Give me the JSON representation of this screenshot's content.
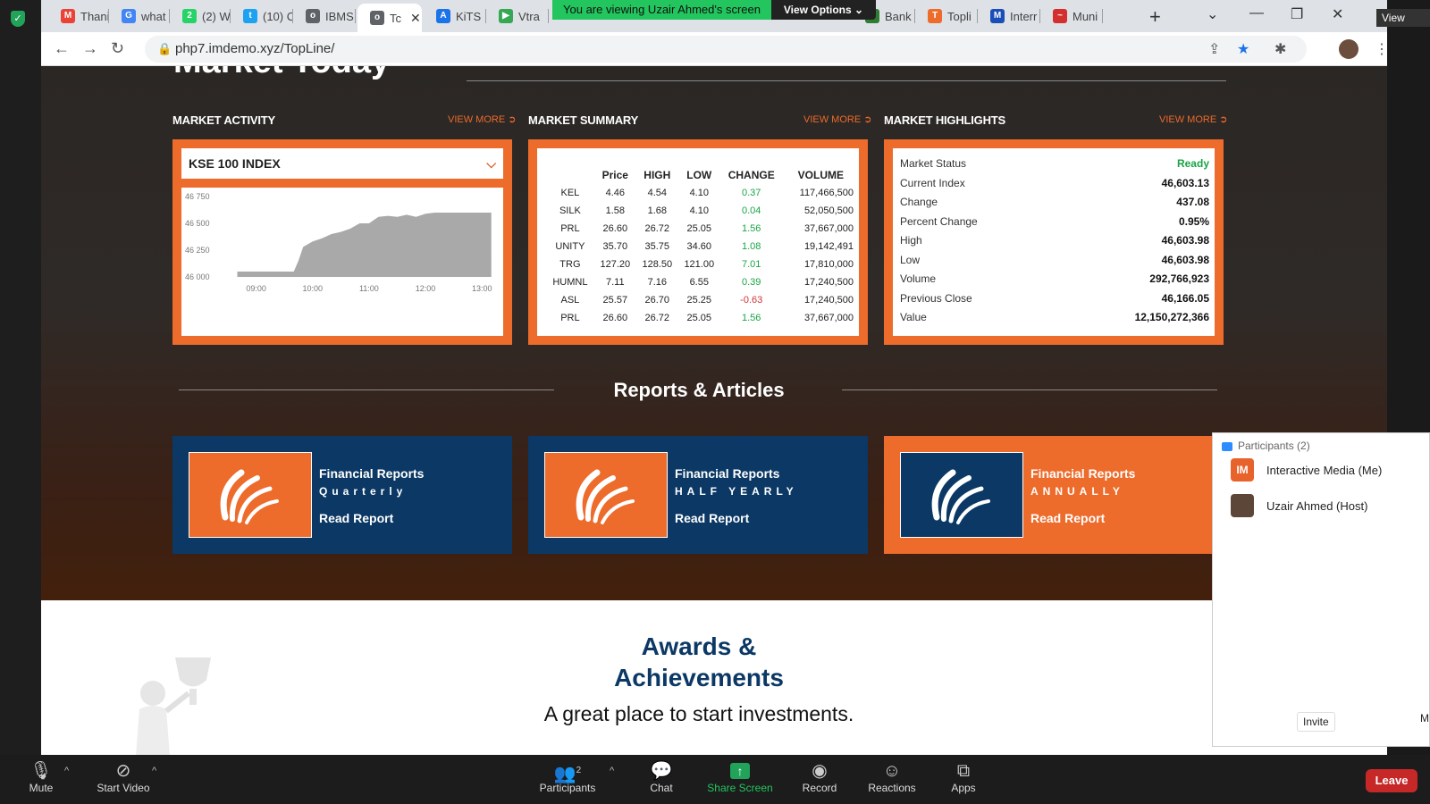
{
  "zoom": {
    "viewing_banner": "You are viewing Uzair Ahmed's screen",
    "view_options": "View Options",
    "view_corner": "View",
    "participants_count": "2",
    "bottom": {
      "mute": "Mute",
      "start_video": "Start Video",
      "participants": "Participants",
      "chat": "Chat",
      "share_screen": "Share Screen",
      "record": "Record",
      "reactions": "Reactions",
      "apps": "Apps",
      "leave": "Leave"
    },
    "participants_panel": {
      "title": "Participants (2)",
      "people": [
        {
          "initials": "IM",
          "name": "Interactive Media (Me)",
          "color": "#e8632b"
        },
        {
          "initials": "",
          "name": "Uzair Ahmed (Host)",
          "color": "#5b4638"
        }
      ],
      "invite": "Invite",
      "more": "M"
    }
  },
  "browser": {
    "tabs": [
      {
        "label": "Thani",
        "icon": "gmail-icon",
        "color": "#ea4335",
        "glyph": "M"
      },
      {
        "label": "what",
        "icon": "google-icon",
        "color": "#4285f4",
        "glyph": "G"
      },
      {
        "label": "(2) W",
        "icon": "whatsapp-icon",
        "color": "#25d366",
        "glyph": "2"
      },
      {
        "label": "(10) C",
        "icon": "twitter-icon",
        "color": "#1da1f2",
        "glyph": "t"
      },
      {
        "label": "IBMS",
        "icon": "globe-icon",
        "color": "#5f6368",
        "glyph": "o"
      },
      {
        "label": "Tc",
        "icon": "globe-icon",
        "color": "#5f6368",
        "glyph": "o",
        "active": true
      },
      {
        "label": "KiTS",
        "icon": "appstore-icon",
        "color": "#1a73e8",
        "glyph": "A"
      },
      {
        "label": "Vtra",
        "icon": "play-icon",
        "color": "#34a853",
        "glyph": "▶"
      },
      {
        "label": "Bank",
        "icon": "bank-icon",
        "color": "#2e7d32",
        "glyph": "B"
      },
      {
        "label": "Topli",
        "icon": "topline-icon",
        "color": "#ed6b2b",
        "glyph": "T"
      },
      {
        "label": "Interr",
        "icon": "meta-icon",
        "color": "#1a4fb8",
        "glyph": "M"
      },
      {
        "label": "Muni",
        "icon": "muni-icon",
        "color": "#d32f2f",
        "glyph": "~"
      }
    ],
    "url": "php7.imdemo.xyz/TopLine/"
  },
  "page": {
    "headline": "Market Today",
    "sections": {
      "activity": "MARKET ACTIVITY",
      "summary": "MARKET SUMMARY",
      "highlights": "MARKET HIGHLIGHTS",
      "view_more": "VIEW MORE"
    },
    "index_select": "KSE 100 INDEX",
    "summary_headers": [
      "",
      "Price",
      "HIGH",
      "LOW",
      "CHANGE",
      "VOLUME"
    ],
    "summary_rows": [
      [
        "KEL",
        "4.46",
        "4.54",
        "4.10",
        "0.37",
        "117,466,500"
      ],
      [
        "SILK",
        "1.58",
        "1.68",
        "4.10",
        "0.04",
        "52,050,500"
      ],
      [
        "PRL",
        "26.60",
        "26.72",
        "25.05",
        "1.56",
        "37,667,000"
      ],
      [
        "UNITY",
        "35.70",
        "35.75",
        "34.60",
        "1.08",
        "19,142,491"
      ],
      [
        "TRG",
        "127.20",
        "128.50",
        "121.00",
        "7.01",
        "17,810,000"
      ],
      [
        "HUMNL",
        "7.11",
        "7.16",
        "6.55",
        "0.39",
        "17,240,500"
      ],
      [
        "ASL",
        "25.57",
        "26.70",
        "25.25",
        "-0.63",
        "17,240,500"
      ],
      [
        "PRL",
        "26.60",
        "26.72",
        "25.05",
        "1.56",
        "37,667,000"
      ]
    ],
    "highlights": [
      {
        "key": "Market Status",
        "value": "Ready"
      },
      {
        "key": "Current Index",
        "value": "46,603.13"
      },
      {
        "key": "Change",
        "value": "437.08"
      },
      {
        "key": "Percent Change",
        "value": "0.95%"
      },
      {
        "key": "High",
        "value": "46,603.98"
      },
      {
        "key": "Low",
        "value": "46,603.98"
      },
      {
        "key": "Volume",
        "value": "292,766,923"
      },
      {
        "key": "Previous Close",
        "value": "46,166.05"
      },
      {
        "key": "Value",
        "value": "12,150,272,366"
      }
    ],
    "reports_title": "Reports & Articles",
    "reports": [
      {
        "title": "Financial Reports",
        "sub": "Quarterly",
        "read": "Read Report",
        "bg": "#0b3864",
        "logo_bg": "#ed6b2b"
      },
      {
        "title": "Financial Reports",
        "sub": "HALF YEARLY",
        "read": "Read Report",
        "bg": "#0b3864",
        "logo_bg": "#ed6b2b"
      },
      {
        "title": "Financial Reports",
        "sub": "ANNUALLY",
        "read": "Read Report",
        "bg": "#ed6b2b",
        "logo_bg": "#0b3864"
      }
    ],
    "awards_line1": "Awards &",
    "awards_line2": "Achievements",
    "invest_tagline": "A great place to start investments."
  },
  "chart_data": {
    "type": "area",
    "title": "KSE 100 INDEX",
    "xlabel": "",
    "ylabel": "",
    "x_ticks": [
      "09:00",
      "10:00",
      "11:00",
      "12:00",
      "13:00"
    ],
    "y_ticks": [
      "46 750",
      "46 500",
      "46 250",
      "46 000"
    ],
    "ylim": [
      46000,
      46750
    ],
    "x": [
      "08:40",
      "09:00",
      "09:20",
      "09:40",
      "09:45",
      "09:50",
      "10:00",
      "10:10",
      "10:20",
      "10:30",
      "10:40",
      "10:50",
      "11:00",
      "11:10",
      "11:20",
      "11:30",
      "11:40",
      "11:50",
      "12:00",
      "12:10",
      "12:20",
      "12:30",
      "12:40",
      "12:50",
      "13:00",
      "13:10"
    ],
    "values": [
      46050,
      46050,
      46050,
      46050,
      46150,
      46280,
      46330,
      46360,
      46400,
      46420,
      46450,
      46500,
      46500,
      46560,
      46570,
      46560,
      46580,
      46560,
      46590,
      46600,
      46600,
      46600,
      46600,
      46600,
      46600,
      46600
    ],
    "grid": false,
    "color": "#a9a9a9"
  }
}
